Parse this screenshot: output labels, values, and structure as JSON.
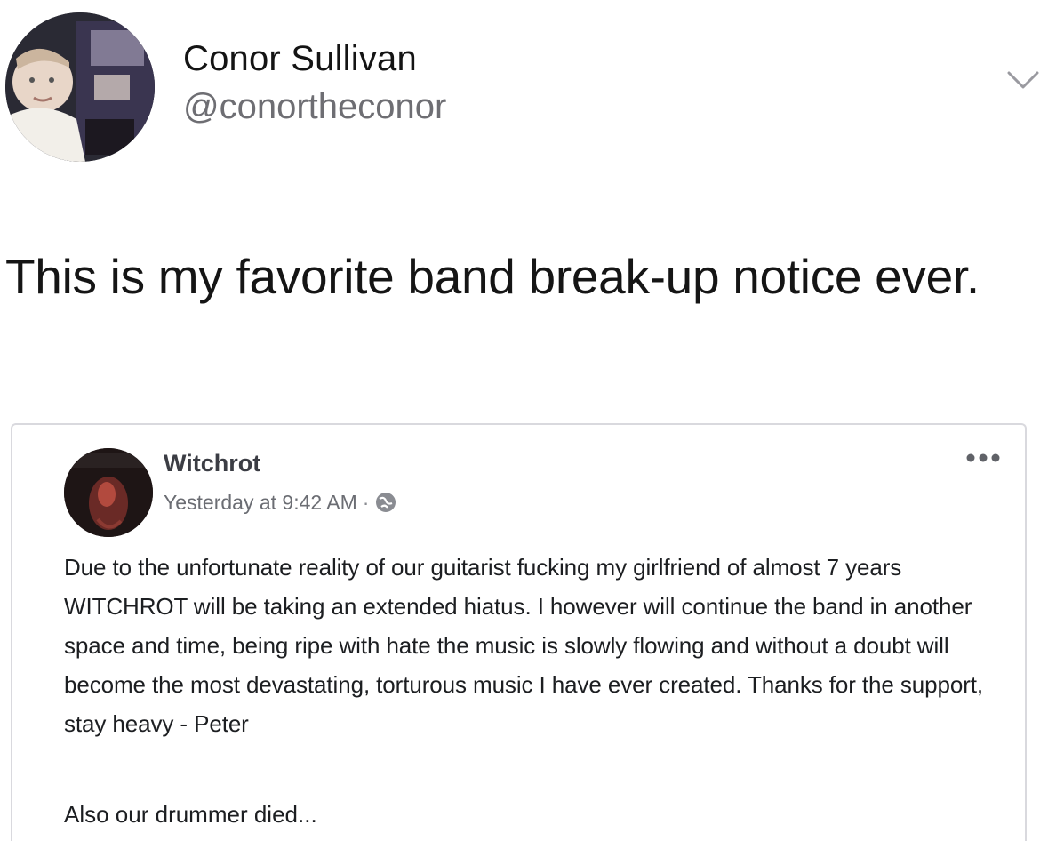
{
  "tweet": {
    "display_name": "Conor Sullivan",
    "handle": "@conortheconor",
    "text": "This is my favorite band break-up notice ever.",
    "avatar_icon": "profile-photo",
    "menu_icon": "chevron-down-icon"
  },
  "fb_post": {
    "page_name": "Witchrot",
    "timestamp": "Yesterday at 9:42 AM",
    "separator": "·",
    "privacy_icon": "globe-icon",
    "more_icon": "more-options-icon",
    "body": "Due to the unfortunate reality of our guitarist fucking my girlfriend of almost 7 years WITCHROT will be taking an extended hiatus. I however will continue the band in another space and time, being ripe with hate the music is slowly flowing and without a doubt will become the most devastating, torturous music I have ever created. Thanks for the support, stay heavy - Peter",
    "postscript": "Also our drummer died...",
    "avatar_label": "WITCHROT"
  },
  "colors": {
    "handle": "#6e6e73",
    "card_border": "#d9d9de",
    "fb_meta": "#6b6d73"
  }
}
